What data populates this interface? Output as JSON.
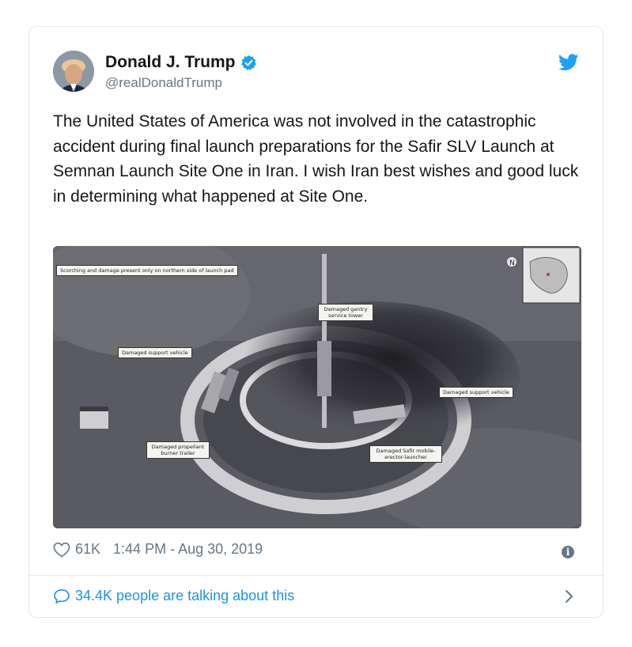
{
  "user": {
    "display_name": "Donald J. Trump",
    "handle": "@realDonaldTrump",
    "verified": true
  },
  "tweet": {
    "text": "The United States of America was not involved in the catastrophic accident during final launch preparations for the Safir SLV Launch at Semnan Launch Site One in Iran. I wish Iran best wishes and good luck in determining what happened at Site One."
  },
  "image": {
    "annotations": {
      "scorch": "Scorching and damage present only on northern side of launch pad",
      "gantry": "Damaged gantry service tower",
      "support_left": "Damaged support vehicle",
      "support_right": "Damaged support vehicle",
      "propellant": "Damaged propellant burner trailer",
      "launcher": "Damaged Safir mobile-erector-launcher"
    }
  },
  "meta": {
    "likes": "61K",
    "timestamp": "1:44 PM - Aug 30, 2019"
  },
  "footer": {
    "talking": "34.4K people are talking about this"
  },
  "colors": {
    "accent": "#1da1f2",
    "link": "#1b95e0",
    "muted": "#657786",
    "border": "#e1e8ed"
  },
  "icons": [
    "verified-badge-icon",
    "twitter-bird-icon",
    "heart-icon",
    "info-icon",
    "comment-bubble-icon",
    "chevron-right-icon"
  ]
}
